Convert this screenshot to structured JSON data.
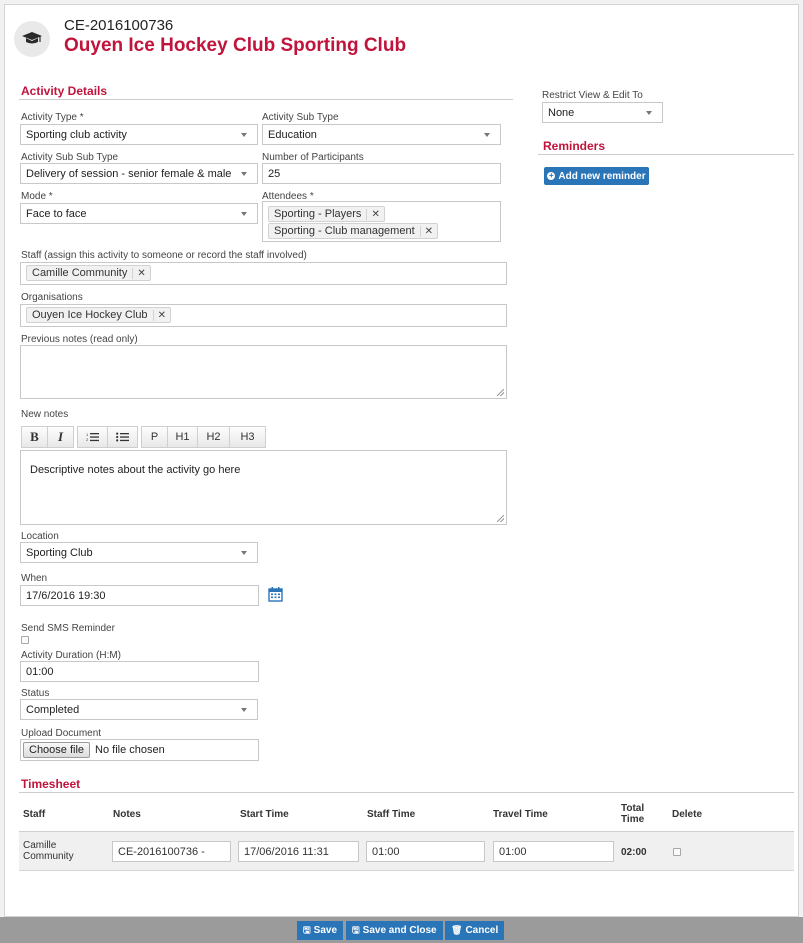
{
  "colors": {
    "accent": "#c0143c",
    "primary_button": "#2a74b8"
  },
  "header": {
    "case_id": "CE-2016100736",
    "club_name": "Ouyen Ice Hockey Club Sporting Club",
    "icon": "graduation-cap-icon"
  },
  "activity_details": {
    "title": "Activity Details",
    "activity_type": {
      "label": "Activity Type *",
      "value": "Sporting club activity"
    },
    "activity_sub_type": {
      "label": "Activity Sub Type",
      "value": "Education"
    },
    "activity_sub_sub_type": {
      "label": "Activity Sub Sub Type",
      "value": "Delivery of session - senior female & male"
    },
    "number_of_participants": {
      "label": "Number of Participants",
      "value": "25"
    },
    "mode": {
      "label": "Mode *",
      "value": "Face to face"
    },
    "attendees": {
      "label": "Attendees *",
      "tags": [
        "Sporting - Players",
        "Sporting - Club management"
      ]
    },
    "staff": {
      "label": "Staff (assign this activity to someone or record the staff involved)",
      "tags": [
        "Camille Community"
      ]
    },
    "organisations": {
      "label": "Organisations",
      "tags": [
        "Ouyen Ice Hockey Club"
      ]
    },
    "previous_notes": {
      "label": "Previous notes (read only)",
      "value": ""
    },
    "new_notes": {
      "label": "New notes",
      "toolbar": {
        "bold": "B",
        "italic": "I",
        "p": "P",
        "h1": "H1",
        "h2": "H2",
        "h3": "H3"
      },
      "value": "Descriptive notes about the activity go here"
    },
    "location": {
      "label": "Location",
      "value": "Sporting Club"
    },
    "when": {
      "label": "When",
      "value": "17/6/2016 19:30"
    },
    "sms_reminder": {
      "label": "Send SMS Reminder",
      "checked": false
    },
    "duration": {
      "label": "Activity Duration (H:M)",
      "value": "01:00"
    },
    "status": {
      "label": "Status",
      "value": "Completed"
    },
    "upload": {
      "label": "Upload Document",
      "button": "Choose file",
      "status": "No file chosen"
    }
  },
  "sidebar": {
    "restrict": {
      "label": "Restrict View & Edit To",
      "value": "None"
    },
    "reminders": {
      "title": "Reminders",
      "add_button": "Add new reminder"
    }
  },
  "timesheet": {
    "title": "Timesheet",
    "headers": {
      "staff": "Staff",
      "notes": "Notes",
      "start_time": "Start Time",
      "staff_time": "Staff Time",
      "travel_time": "Travel Time",
      "total_time_1": "Total",
      "total_time_2": "Time",
      "delete": "Delete"
    },
    "row": {
      "staff_1": "Camille",
      "staff_2": "Community",
      "notes": "CE-2016100736 -",
      "start_time": "17/06/2016 11:31",
      "staff_time": "01:00",
      "travel_time": "01:00",
      "total_time": "02:00"
    }
  },
  "footer": {
    "save": "Save",
    "save_close": "Save and Close",
    "cancel": "Cancel"
  }
}
